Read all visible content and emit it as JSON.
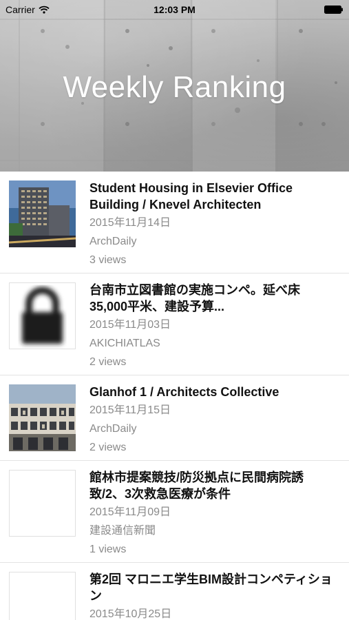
{
  "status_bar": {
    "carrier": "Carrier",
    "time": "12:03 PM",
    "wifi_icon": "wifi-icon",
    "battery_icon": "battery-icon"
  },
  "header": {
    "title": "Weekly Ranking",
    "background": "concrete-texture"
  },
  "items": [
    {
      "title": "Student Housing in Elsevier Office Building / Knevel Architecten",
      "date": "2015年11月14日",
      "source": "ArchDaily",
      "views": "3 views",
      "thumbnail": "building-photo"
    },
    {
      "title": "台南市立図書館の実施コンペ。延べ床35,000平米、建設予算...",
      "date": "2015年11月03日",
      "source": "AKICHIATLAS",
      "views": "2 views",
      "thumbnail": "lock-icon"
    },
    {
      "title": "Glanhof 1 / Architects Collective",
      "date": "2015年11月15日",
      "source": "ArchDaily",
      "views": "2 views",
      "thumbnail": "building-facade-photo"
    },
    {
      "title": "館林市提案競技/防災拠点に民間病院誘致/2、3次救急医療が条件",
      "date": "2015年11月09日",
      "source": "建設通信新聞",
      "views": "1 views",
      "thumbnail": "blank-thumbnail"
    },
    {
      "title": "第2回 マロニエ学生BIM設計コンペティション",
      "date": "2015年10月25日",
      "thumbnail": "blank-thumbnail"
    }
  ]
}
